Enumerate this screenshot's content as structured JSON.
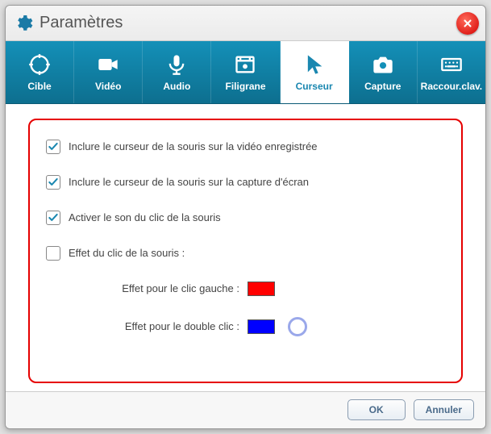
{
  "window": {
    "title": "Paramètres"
  },
  "tabs": [
    {
      "id": "cible",
      "label": "Cible"
    },
    {
      "id": "video",
      "label": "Vidéo"
    },
    {
      "id": "audio",
      "label": "Audio"
    },
    {
      "id": "filigrane",
      "label": "Filigrane"
    },
    {
      "id": "curseur",
      "label": "Curseur"
    },
    {
      "id": "capture",
      "label": "Capture"
    },
    {
      "id": "raccourclav",
      "label": "Raccour.clav."
    }
  ],
  "active_tab": "curseur",
  "options": {
    "include_cursor_video": {
      "checked": true,
      "label": "Inclure le curseur de la souris sur la vidéo enregistrée"
    },
    "include_cursor_screenshot": {
      "checked": true,
      "label": "Inclure le curseur de la souris sur la capture d'écran"
    },
    "click_sound": {
      "checked": true,
      "label": "Activer le son du clic de la souris"
    },
    "click_effect": {
      "checked": false,
      "label": "Effet du clic de la souris :"
    },
    "left_click_label": "Effet pour le clic gauche :",
    "double_click_label": "Effet pour le double clic :",
    "left_click_color": "#ff0000",
    "double_click_color": "#0000ff"
  },
  "buttons": {
    "ok": "OK",
    "cancel": "Annuler"
  }
}
